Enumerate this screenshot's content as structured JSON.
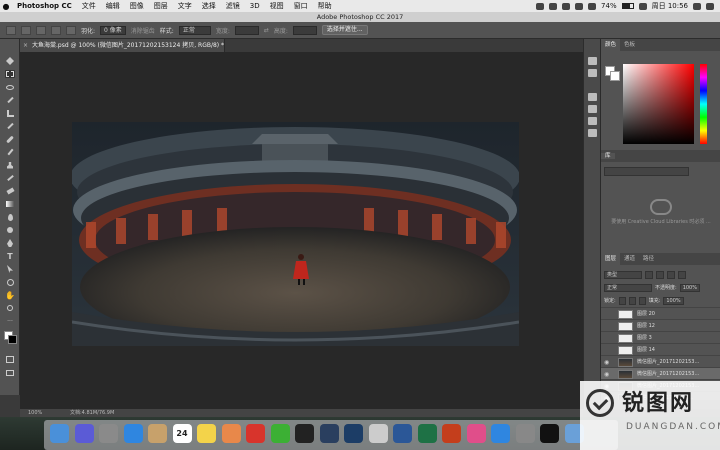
{
  "menubar": {
    "app_name": "Photoshop CC",
    "items": [
      "文件",
      "编辑",
      "图像",
      "图层",
      "文字",
      "选择",
      "滤镜",
      "3D",
      "视图",
      "窗口",
      "帮助"
    ],
    "battery": "74%",
    "clock": "周日 10:56"
  },
  "window": {
    "title": "Adobe Photoshop CC 2017"
  },
  "options_bar": {
    "feather_label": "羽化:",
    "feather_value": "0 像素",
    "antialias_label": "消除锯齿",
    "style_label": "样式:",
    "style_value": "正常",
    "width_label": "宽度:",
    "height_label": "高度:",
    "select_mask_button": "选择并遮住..."
  },
  "document_tab": {
    "title": "大鱼海棠.psd @ 100% (微信图片_20171202153124 拷贝, RGB/8) *",
    "close": "×"
  },
  "status": {
    "zoom": "100%",
    "doc_size": "文档:4.81M/76.9M"
  },
  "panels": {
    "color_tabs": [
      "颜色",
      "色板"
    ],
    "library_tabs": [
      "库"
    ],
    "library_message": "要使用 Creative Cloud Libraries 时必须 ...",
    "layers_tabs": [
      "图层",
      "通道",
      "路径"
    ],
    "layer_filter": "类型",
    "blend_mode": "正常",
    "opacity_label": "不透明度:",
    "opacity_value": "100%",
    "lock_label": "锁定:",
    "fill_label": "填充:",
    "fill_value": "100%",
    "layers": [
      {
        "name": "图层 20",
        "visible": false,
        "kind": "blank"
      },
      {
        "name": "图层 12",
        "visible": false,
        "kind": "blank"
      },
      {
        "name": "图层 3",
        "visible": false,
        "kind": "blank"
      },
      {
        "name": "图层 14",
        "visible": false,
        "kind": "blank"
      },
      {
        "name": "微信图片_20171202153...",
        "visible": true,
        "kind": "photo"
      },
      {
        "name": "微信图片_20171202153...",
        "visible": true,
        "kind": "photo",
        "selected": true
      },
      {
        "name": "微信图片_20171202153...",
        "visible": true,
        "kind": "photo"
      },
      {
        "name": "微信图片_201712021...",
        "visible": true,
        "kind": "photo"
      }
    ]
  },
  "dock": {
    "calendar_day": "24",
    "apps": [
      "finder-icon",
      "siri-icon",
      "launchpad-icon",
      "safari-icon",
      "notes-icon",
      "calendar-icon",
      "stickies-icon",
      "photos-icon",
      "music163-icon",
      "wechat-icon",
      "qq-icon",
      "lightroom-icon",
      "photoshop-icon",
      "preview-icon",
      "word-icon",
      "excel-icon",
      "powerpoint-icon",
      "itunes-icon",
      "appstore-icon",
      "settings-icon",
      "terminal-icon",
      "downloads-icon"
    ]
  },
  "watermark": {
    "text": "锐图网",
    "sub": "DUANGDAN.COM"
  },
  "colors": {
    "accent": "#3d77c8",
    "panel": "#535353",
    "canvas": "#282828"
  }
}
